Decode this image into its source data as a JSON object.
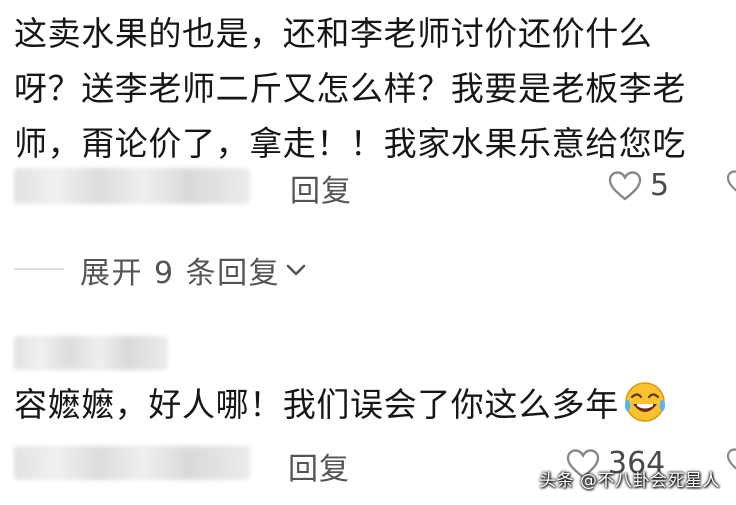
{
  "comment1": {
    "text": "这卖水果的也是，还和李老师讨价还价什么\n呀？送李老师二斤又怎么样？我要是老板李老\n师，甭论价了，拿走！！我家水果乐意给您吃",
    "reply_label": "回复",
    "like_count": "5"
  },
  "expand_replies": {
    "label": "展开 9 条回复"
  },
  "comment2": {
    "text": "容嬷嬷，好人哪！我们误会了你这么多年",
    "emoji": "rofl-emoji",
    "reply_label": "回复",
    "like_count": "364"
  },
  "watermark": "头条 @不八卦会死星人",
  "colors": {
    "text": "#161616",
    "secondary": "#555555",
    "emoji_face": "#f9c22e"
  }
}
